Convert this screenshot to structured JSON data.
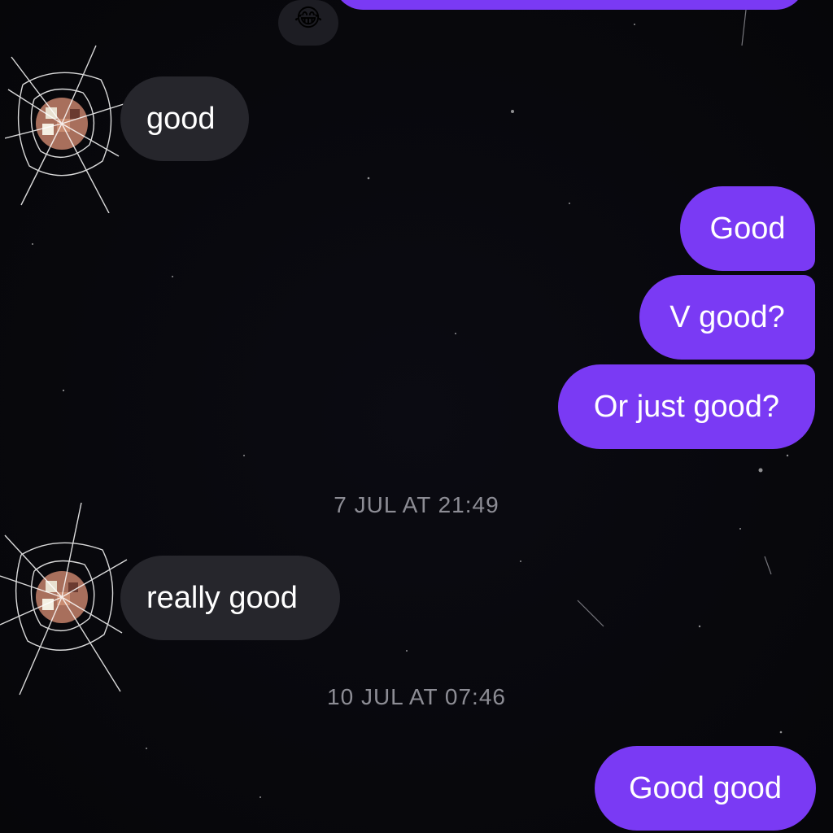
{
  "conversation": {
    "top_reaction": "😂",
    "messages_top": [
      {
        "id": "in-1",
        "text": "good"
      },
      {
        "id": "out-1",
        "text": "Good"
      },
      {
        "id": "out-2",
        "text": "V good?"
      },
      {
        "id": "out-3",
        "text": "Or just good?"
      }
    ],
    "timestamp_1": "7 JUL AT 21:49",
    "incoming_2": "really good",
    "timestamp_2": "10 JUL AT 07:46",
    "outgoing_last": "Good good"
  },
  "colors": {
    "background": "#07070b",
    "outgoing_bubble": "#7a3af4",
    "incoming_bubble": "#26262c",
    "timestamp_text": "#8d8d95"
  },
  "icons": [
    "laughing-emoji-reaction",
    "avatar-cracked-glass"
  ]
}
